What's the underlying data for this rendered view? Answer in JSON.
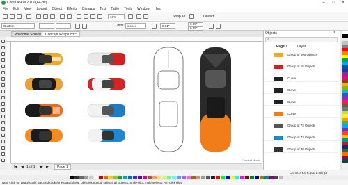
{
  "app": {
    "title": "CorelDRAW 2019 (64-Bit)"
  },
  "menu": [
    "File",
    "Edit",
    "View",
    "Layout",
    "Object",
    "Effects",
    "Bitmaps",
    "Text",
    "Table",
    "Tools",
    "Window",
    "Help"
  ],
  "toolbar1": {
    "zoom": "13%",
    "snap_label": "Snap To",
    "launch_label": "Launch"
  },
  "toolbar2": {
    "preset": "Custom",
    "units_label": "Units:",
    "units": "inches",
    "nudge": "0.01\"",
    "dup_x": "0.25\"",
    "dup_y": "0.25\""
  },
  "tabs": [
    {
      "label": "Welcome Screen"
    },
    {
      "label": "Concept Wraps.cdr*"
    }
  ],
  "objects_docker": {
    "title": "Objects",
    "page_label": "Page 1",
    "layer_label": "Layer 1",
    "rows": [
      "Group of 100 Objects",
      "Group of 15 Objects",
      "Curve",
      "Curve",
      "Curve",
      "Curve",
      "Group of 73 Objects",
      "Group of 73 Objects",
      "Group of 40 Objects"
    ]
  },
  "pagebar": {
    "page_count": "1 of 1",
    "page_tab": "Page 1"
  },
  "canvas_note": "Connect Mode",
  "status": {
    "coords": "C:0 M:0 Y:0 K:100  0.567 pt"
  },
  "hint": "Next click for Drag/Scale; Second click for Rotate/Skew; Dbl-clicking tool selects all objects; Shift+click multi-selects; Alt+click digs",
  "palette": [
    "#ffffff",
    "#000000",
    "#e8e8e8",
    "#c0c0c0",
    "#808080",
    "#ff0000",
    "#ff7f00",
    "#ffff00",
    "#00a651",
    "#00aeef",
    "#0054a6",
    "#2e3192",
    "#92278f",
    "#ec008c",
    "#8b4513",
    "#f5a623",
    "#7fba00",
    "#00bcd4",
    "#3f51b5",
    "#9c27b0",
    "#e91e63",
    "#795548",
    "#607d8b",
    "#cddc39",
    "#ffeb3b",
    "#ff9800",
    "#4caf50",
    "#03a9f4",
    "#673ab7",
    "#f44336",
    "#ffc107",
    "#009688",
    "#b71c1c",
    "#1a237e",
    "#33691e",
    "#ff6f00",
    "#880e4f",
    "#004d40"
  ],
  "colorbar": [
    "#000",
    "#333",
    "#666",
    "#999",
    "#ccc",
    "#fff",
    "#c00",
    "#e60",
    "#fc0",
    "#9c0",
    "#0a4",
    "#0aa",
    "#06c",
    "#33c",
    "#609",
    "#c09",
    "#a52",
    "#f96",
    "#fd6",
    "#cf6",
    "#6f9",
    "#6ff",
    "#69f",
    "#96f",
    "#f6c",
    "#963",
    "#c96",
    "#999",
    "#555",
    "#222",
    "#f00",
    "#0f0",
    "#00f",
    "#ff0",
    "#0ff",
    "#f0f",
    "#800",
    "#080",
    "#008",
    "#880",
    "#088",
    "#808",
    "#444",
    "#bbb"
  ]
}
